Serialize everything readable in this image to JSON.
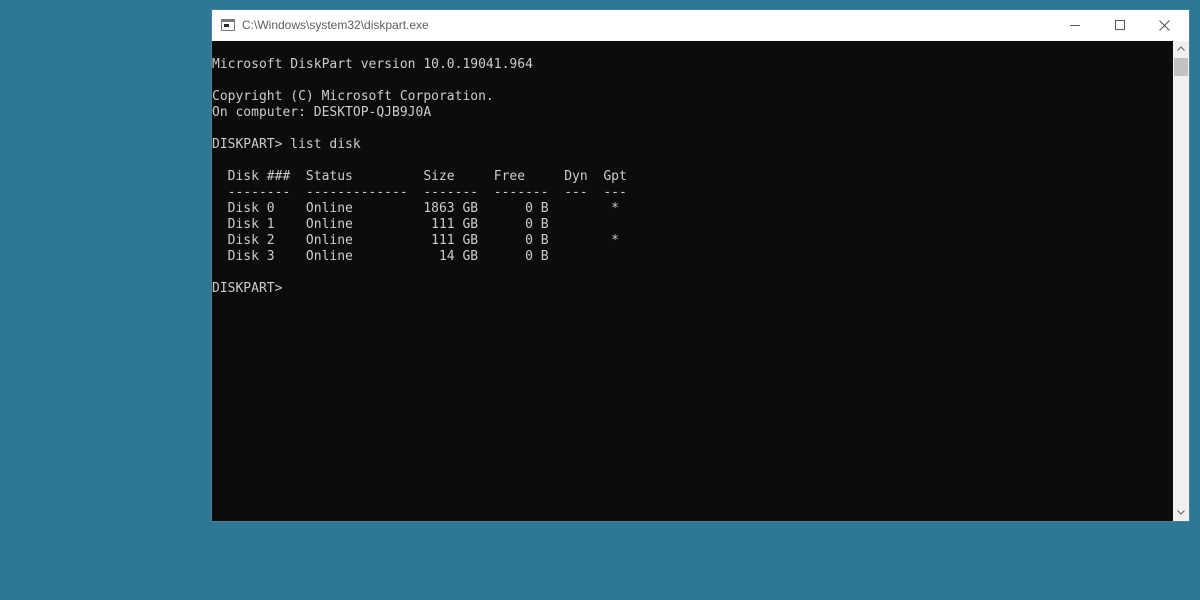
{
  "window": {
    "title": "C:\\Windows\\system32\\diskpart.exe",
    "icons": {
      "app": "console-icon",
      "minimize": "minimize-icon",
      "maximize": "maximize-icon",
      "close": "close-icon",
      "scroll_up": "chevron-up-icon",
      "scroll_down": "chevron-down-icon"
    }
  },
  "console": {
    "lines": [
      "",
      "Microsoft DiskPart version 10.0.19041.964",
      "",
      "Copyright (C) Microsoft Corporation.",
      "On computer: DESKTOP-QJB9J0A",
      "",
      "DISKPART> list disk",
      "",
      "  Disk ###  Status         Size     Free     Dyn  Gpt",
      "  --------  -------------  -------  -------  ---  ---",
      "  Disk 0    Online         1863 GB      0 B        *",
      "  Disk 1    Online          111 GB      0 B",
      "  Disk 2    Online          111 GB      0 B        *",
      "  Disk 3    Online           14 GB      0 B",
      "",
      "DISKPART> "
    ]
  },
  "colors": {
    "desktop": "#2d7896",
    "console_bg": "#0c0c0c",
    "console_text": "#cccccc"
  }
}
